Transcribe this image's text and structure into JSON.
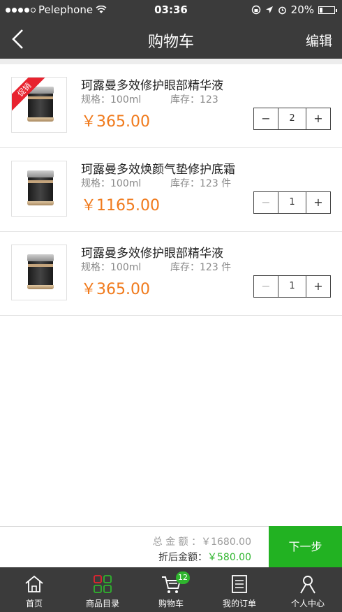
{
  "status_bar": {
    "carrier": "Pelephone",
    "time": "03:36",
    "battery": "20%",
    "battery_level": 0.2
  },
  "header": {
    "title": "购物车",
    "edit_label": "编辑"
  },
  "items": [
    {
      "name": "珂露曼多效修护眼部精华液",
      "spec": "规格：100ml",
      "stock": "库存：123",
      "price": "￥365.00",
      "quantity": "2",
      "minus": "−",
      "plus": "+",
      "promo": "促销",
      "minus_enabled": true
    },
    {
      "name": "珂露曼多效焕颜气垫修护底霜",
      "spec": "规格：100ml",
      "stock": "库存：123 件",
      "price": "￥1165.00",
      "quantity": "1",
      "minus": "−",
      "plus": "+",
      "minus_enabled": false
    },
    {
      "name": "珂露曼多效修护眼部精华液",
      "spec": "规格：100ml",
      "stock": "库存：123 件",
      "price": "￥365.00",
      "quantity": "1",
      "minus": "−",
      "plus": "+",
      "minus_enabled": false
    }
  ],
  "checkout": {
    "total_label": "总 金 额 ：",
    "total_value": "￥1680.00",
    "discount_label": "折后金额：",
    "discount_value": "￥580.00",
    "next_label": "下一步"
  },
  "tabbar": {
    "tabs": [
      {
        "label": "首页",
        "icon": "home-icon"
      },
      {
        "label": "商品目录",
        "icon": "grid-icon"
      },
      {
        "label": "购物车",
        "icon": "cart-icon",
        "badge": "12"
      },
      {
        "label": "我的订单",
        "icon": "order-list-icon"
      },
      {
        "label": "个人中心",
        "icon": "person-icon"
      }
    ]
  },
  "colors": {
    "bar_bg": "#3b3b3b",
    "price": "#f07a1c",
    "accent_green": "#22b222",
    "promo_red": "#e8232f"
  }
}
